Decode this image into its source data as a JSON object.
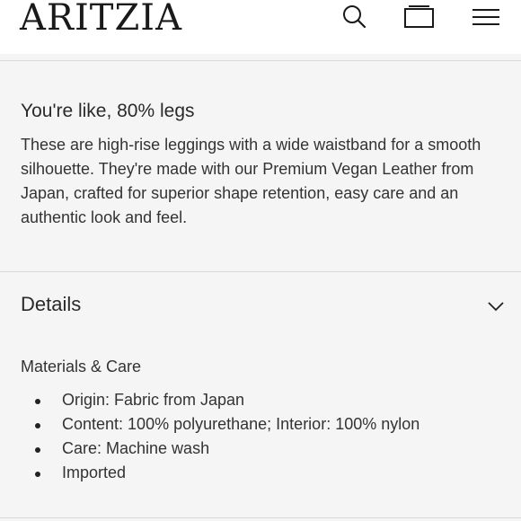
{
  "header": {
    "logo": "ARITZIA",
    "icons": [
      "search-icon",
      "shopping-bag-icon",
      "menu-icon"
    ]
  },
  "description": {
    "title": "You're like, 80% legs",
    "body": "These are high-rise leggings with a wide waistband for a smooth silhouette. They're made with our Premium Vegan Leather from Japan, crafted for superior shape retention, easy care and an authentic look and feel."
  },
  "details": {
    "title": "Details",
    "expanded": true,
    "materials_title": "Materials & Care",
    "items": [
      "Origin: Fabric from Japan",
      "Content: 100% polyurethane; Interior: 100% nylon",
      "Care: Machine wash",
      "Imported"
    ]
  }
}
